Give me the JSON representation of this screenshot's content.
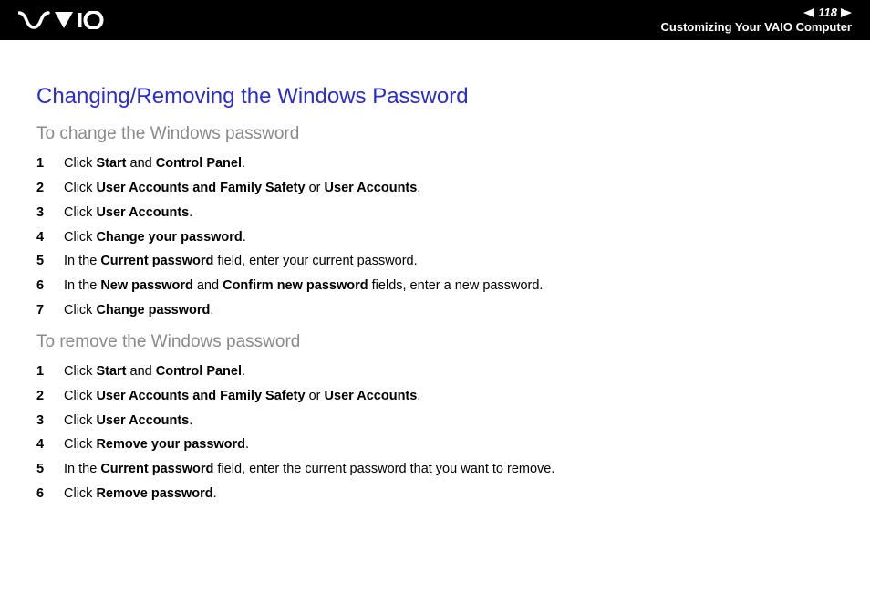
{
  "header": {
    "page_number": "118",
    "breadcrumb": "Customizing Your VAIO Computer"
  },
  "main": {
    "title": "Changing/Removing the Windows Password",
    "section_change": {
      "heading": "To change the Windows password",
      "steps": [
        [
          [
            "Click "
          ],
          [
            "b",
            "Start"
          ],
          [
            " and "
          ],
          [
            "b",
            "Control Panel"
          ],
          [
            "."
          ]
        ],
        [
          [
            "Click "
          ],
          [
            "b",
            "User Accounts and Family Safety"
          ],
          [
            " or "
          ],
          [
            "b",
            "User Accounts"
          ],
          [
            "."
          ]
        ],
        [
          [
            "Click "
          ],
          [
            "b",
            "User Accounts"
          ],
          [
            "."
          ]
        ],
        [
          [
            "Click "
          ],
          [
            "b",
            "Change your password"
          ],
          [
            "."
          ]
        ],
        [
          [
            "In the "
          ],
          [
            "b",
            "Current password"
          ],
          [
            " field, enter your current password."
          ]
        ],
        [
          [
            "In the "
          ],
          [
            "b",
            "New password"
          ],
          [
            " and "
          ],
          [
            "b",
            "Confirm new password"
          ],
          [
            " fields, enter a new password."
          ]
        ],
        [
          [
            "Click "
          ],
          [
            "b",
            "Change password"
          ],
          [
            "."
          ]
        ]
      ]
    },
    "section_remove": {
      "heading": "To remove the Windows password",
      "steps": [
        [
          [
            "Click "
          ],
          [
            "b",
            "Start"
          ],
          [
            " and "
          ],
          [
            "b",
            "Control Panel"
          ],
          [
            "."
          ]
        ],
        [
          [
            "Click "
          ],
          [
            "b",
            "User Accounts and Family Safety"
          ],
          [
            " or "
          ],
          [
            "b",
            "User Accounts"
          ],
          [
            "."
          ]
        ],
        [
          [
            "Click "
          ],
          [
            "b",
            "User Accounts"
          ],
          [
            "."
          ]
        ],
        [
          [
            "Click "
          ],
          [
            "b",
            "Remove your password"
          ],
          [
            "."
          ]
        ],
        [
          [
            "In the "
          ],
          [
            "b",
            "Current password"
          ],
          [
            " field, enter the current password that you want to remove."
          ]
        ],
        [
          [
            "Click "
          ],
          [
            "b",
            "Remove password"
          ],
          [
            "."
          ]
        ]
      ]
    }
  }
}
